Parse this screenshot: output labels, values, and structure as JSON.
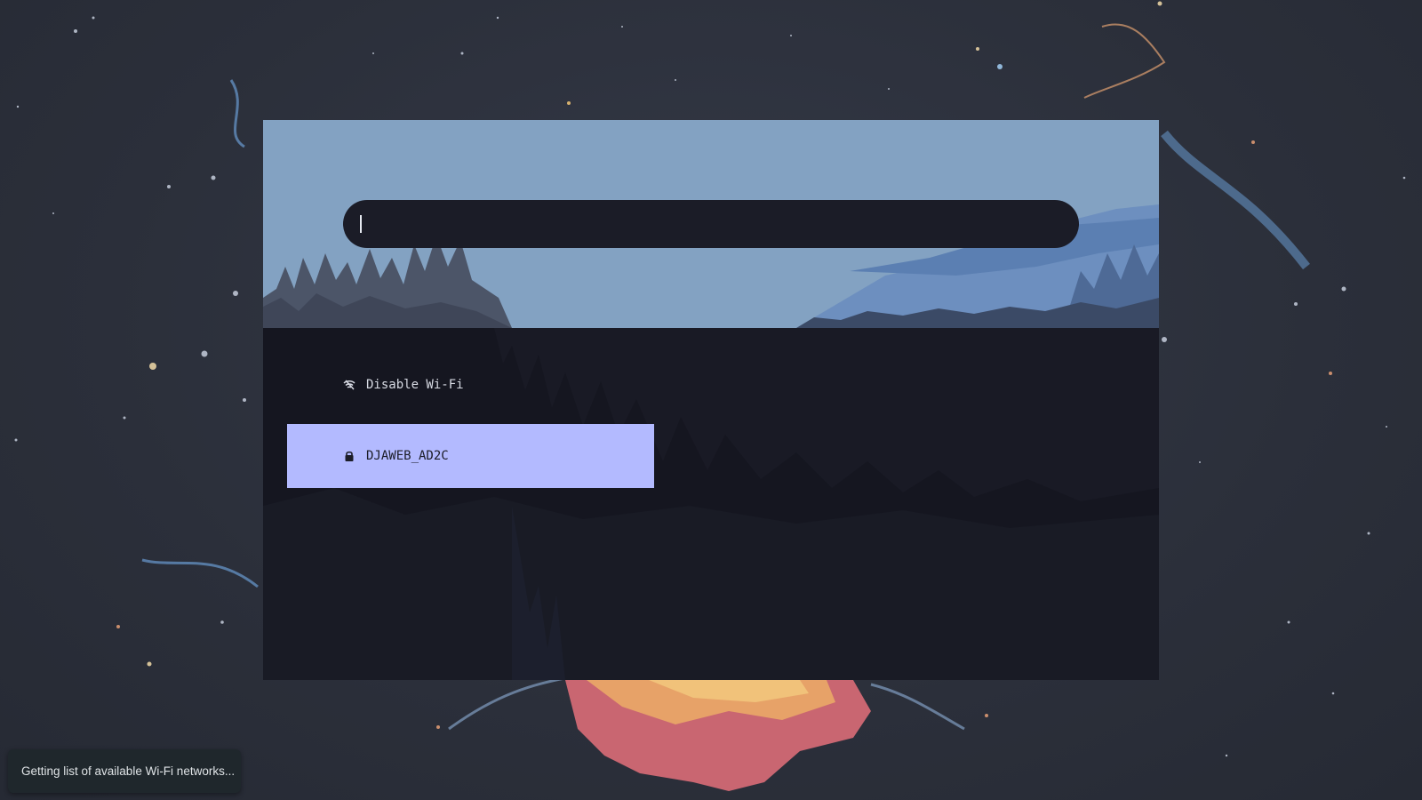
{
  "launcher": {
    "search": {
      "value": "",
      "placeholder": ""
    },
    "entries": [
      {
        "label": "Disable Wi-Fi",
        "icon": "wifi-off-icon",
        "selected": false
      },
      {
        "label": "DJAWEB_AD2C",
        "icon": "lock-icon",
        "selected": true
      }
    ]
  },
  "notification": {
    "text": "Getting list of available Wi-Fi networks..."
  },
  "colors": {
    "desktop_bg": "#2e323d",
    "header_sky": "#83a2c2",
    "list_bg": "#151620",
    "search_bg": "#1b1c27",
    "selected_bg": "#b3baff",
    "toast_bg": "#1f272c"
  }
}
